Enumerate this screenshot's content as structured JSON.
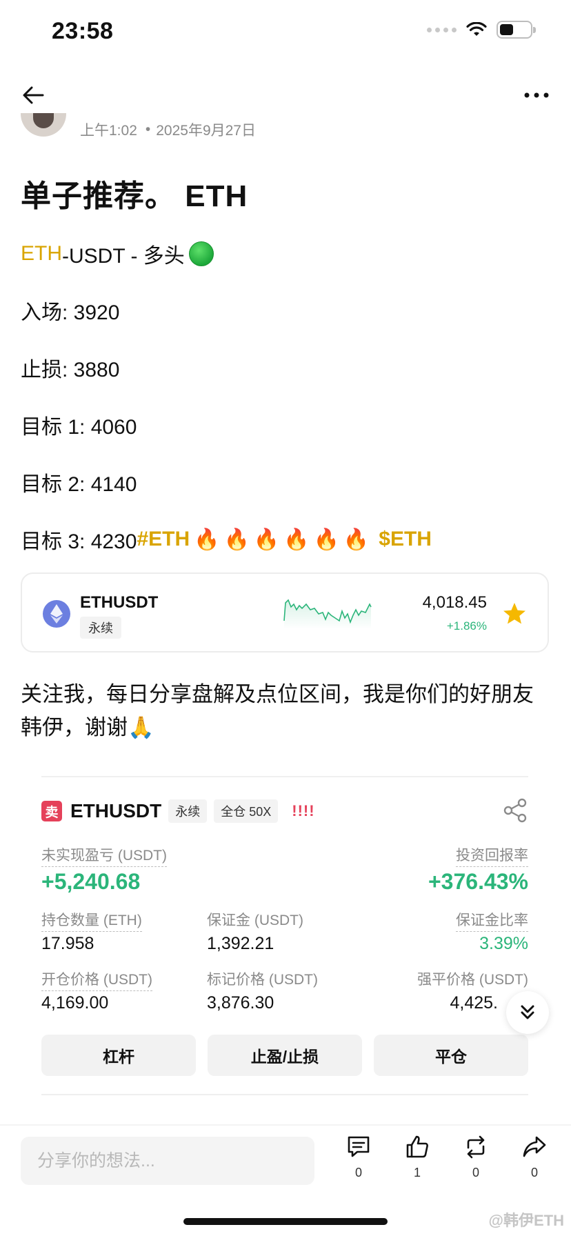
{
  "status_bar": {
    "time": "23:58",
    "battery_level": 0.45
  },
  "post": {
    "time": "上午1:02",
    "separator": "•",
    "date": "2025年9月27日",
    "title": "单子推荐。 ETH",
    "pair_coin": "ETH",
    "pair_rest": "-USDT - 多头",
    "entry": "入场: 3920",
    "stop_loss": "止损: 3880",
    "target1": "目标 1: 4060",
    "target2": "目标 2: 4140",
    "target3_text": "目标 3: 4230",
    "hashtag": "#ETH",
    "fire_emoji": [
      "🔥",
      "🔥",
      "🔥",
      "🔥",
      "🔥",
      "🔥"
    ],
    "cashtag": "$ETH",
    "paragraph": " 关注我，每日分享盘解及点位区间，我是你们的好朋友韩伊，谢谢🙏"
  },
  "ticker": {
    "symbol": "ETHUSDT",
    "type": "永续",
    "price": "4,018.45",
    "change": "+1.86%",
    "colors": {
      "up": "#2bb57a",
      "star": "#f5b800"
    }
  },
  "position": {
    "side_badge": "卖",
    "symbol": "ETHUSDT",
    "type": "永续",
    "margin_mode": "全仓 50X",
    "warning": "!!!!",
    "unrealized_pnl_label": "未实现盈亏 (USDT)",
    "unrealized_pnl": "+5,240.68",
    "roi_label": "投资回报率",
    "roi": "+376.43%",
    "size_label": "持仓数量 (ETH)",
    "size": "17.958",
    "margin_label": "保证金 (USDT)",
    "margin": "1,392.21",
    "margin_ratio_label": "保证金比率",
    "margin_ratio": "3.39%",
    "entry_price_label": "开仓价格 (USDT)",
    "entry_price": "4,169.00",
    "mark_price_label": "标记价格 (USDT)",
    "mark_price": "3,876.30",
    "liq_price_label": "强平价格 (USDT)",
    "liq_price": "4,425.",
    "buttons": {
      "leverage": "杠杆",
      "tpsl": "止盈/止损",
      "close": "平仓"
    },
    "colors": {
      "sell": "#e5415a",
      "profit": "#2bb57a"
    }
  },
  "bottom_bar": {
    "comment_placeholder": "分享你的想法...",
    "comment_count": "0",
    "like_count": "1",
    "repost_count": "0",
    "share_count": "0",
    "watermark": "@韩伊ETH"
  }
}
